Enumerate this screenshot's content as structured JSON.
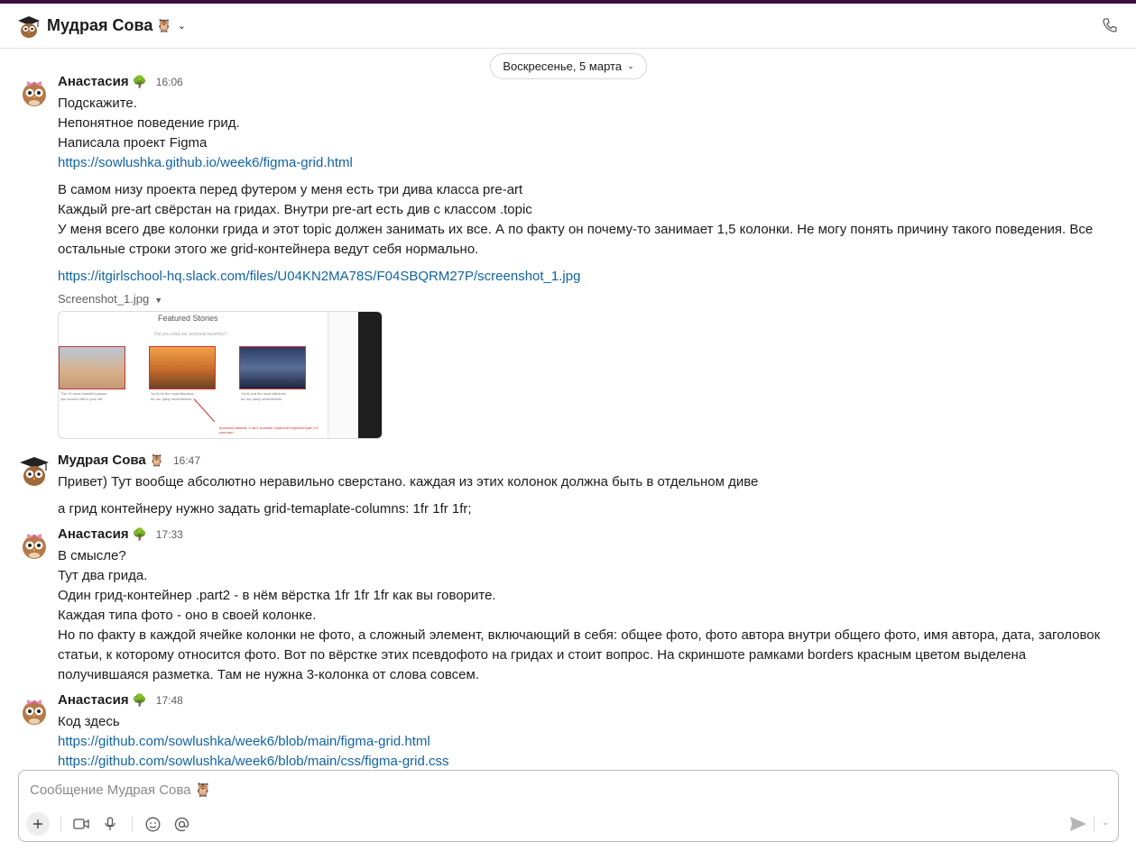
{
  "channel": {
    "title": "Мудрая Сова",
    "title_emoji": "🦉",
    "date_divider": "Воскресенье, 5 марта"
  },
  "messages": [
    {
      "author": "Анастасия",
      "author_emoji": "🌳",
      "time": "16:06",
      "lines": [
        "Подскажите.",
        "Непонятное поведение грид.",
        "Написала проект Figma"
      ],
      "link1": "https://sowlushka.github.io/week6/figma-grid.html",
      "para2": [
        "В самом низу проекта перед футером у меня есть три дива класса pre-art",
        "Каждый pre-art свёрстан на гридах. Внутри pre-art есть див с классом .topic",
        "У меня всего две колонки грида и этот topic должен занимать их все. А по факту он почему-то занимает 1,5 колонки. Не могу понять причину такого поведения. Все остальные строки этого же grid-контейнера ведут себя нормально."
      ],
      "link2": "https://itgirlschool-hq.slack.com/files/U04KN2MA78S/F04SBQRM27P/screenshot_1.jpg",
      "file_name": "Screenshot_1.jpg",
      "preview": {
        "title": "Featured Stories",
        "subtitle": "Did you read our personal favorites?",
        "captions": [
          "The 10 most beautiful places you should visit in your life",
          "You'll hit the most fabulous for our party nevertheless",
          "You'll and the most fabulous for our party nevertheless"
        ],
        "annotation": "Красной рамкой: 3 на 2 колонки. Красной стрелкой уже 1,5 колонки..."
      }
    },
    {
      "author": "Мудрая Сова",
      "author_emoji": "🦉",
      "time": "16:47",
      "lines": [
        "Привет) Тут вообще абсолютно неравильно сверстано. каждая из этих колонок должна быть в отдельном диве"
      ],
      "para2": "а грид контейнеру нужно задать grid-temaplate-columns: 1fr 1fr 1fr;"
    },
    {
      "author": "Анастасия",
      "author_emoji": "🌳",
      "time": "17:33",
      "lines": [
        "В смысле?",
        "Тут два грида.",
        "Один грид-контейнер .part2 - в нём вёрстка 1fr 1fr 1fr как вы говорите.",
        "Каждая типа фото - оно в своей колонке.",
        "Но по факту в каждой ячейке колонки не фото, а сложный элемент, включающий в себя: общее фото, фото автора внутри общего фото, имя автора, дата, заголовок статьи, к которому относится фото. Вот по вёрстке этих псевдофото на гридах и стоит вопрос. На скриншоте рамками borders красным цветом выделена получившаяся разметка. Там не нужна 3-колонка от слова совсем."
      ]
    },
    {
      "author": "Анастасия",
      "author_emoji": "🌳",
      "time": "17:48",
      "lines": [
        "Код здесь"
      ],
      "link1": "https://github.com/sowlushka/week6/blob/main/figma-grid.html",
      "link2": "https://github.com/sowlushka/week6/blob/main/css/figma-grid.css"
    }
  ],
  "composer": {
    "placeholder": "Сообщение Мудрая Сова 🦉"
  },
  "icons": {
    "phone": "phone-icon",
    "plus": "plus-icon",
    "video": "video-icon",
    "mic": "microphone-icon",
    "emoji": "emoji-icon",
    "mention": "mention-icon",
    "send": "send-icon"
  },
  "colors": {
    "link": "#1264a3",
    "topbar": "#3f0e40"
  }
}
